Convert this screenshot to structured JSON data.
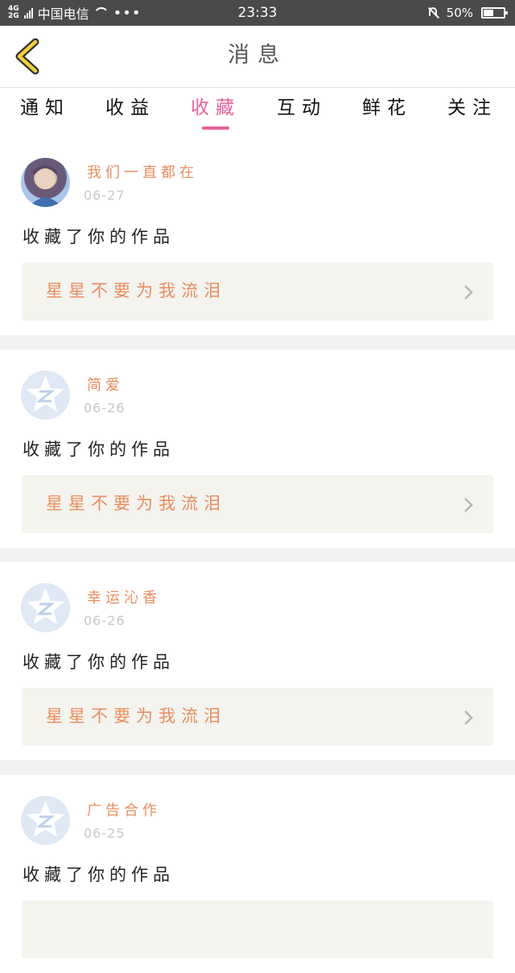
{
  "status_bar": {
    "network_top": "4G",
    "network_bottom": "2G",
    "carrier": "中国电信",
    "more": "•••",
    "time": "23:33",
    "battery": "50%",
    "battery_level": 0.5
  },
  "header": {
    "back_icon": "chevron-left-icon",
    "title": "消息"
  },
  "tabs": [
    {
      "label": "通知",
      "active": false
    },
    {
      "label": "收益",
      "active": false
    },
    {
      "label": "收藏",
      "active": true
    },
    {
      "label": "互动",
      "active": false
    },
    {
      "label": "鲜花",
      "active": false
    },
    {
      "label": "关注",
      "active": false
    }
  ],
  "colors": {
    "accent": "#e8629a",
    "username": "#e88d5f",
    "work_bg": "#f4f3ee",
    "separator": "#f2f2f2"
  },
  "messages": [
    {
      "user": "我们一直都在",
      "date": "06-27",
      "action": "收藏了你的作品",
      "work": "星星不要为我流泪",
      "avatar": "photo"
    },
    {
      "user": "简爱",
      "date": "06-26",
      "action": "收藏了你的作品",
      "work": "星星不要为我流泪",
      "avatar": "default-star-icon"
    },
    {
      "user": "幸运沁香",
      "date": "06-26",
      "action": "收藏了你的作品",
      "work": "星星不要为我流泪",
      "avatar": "default-star-icon"
    },
    {
      "user": "广告合作",
      "date": "06-25",
      "action": "收藏了你的作品",
      "work": "",
      "avatar": "default-star-icon"
    }
  ]
}
